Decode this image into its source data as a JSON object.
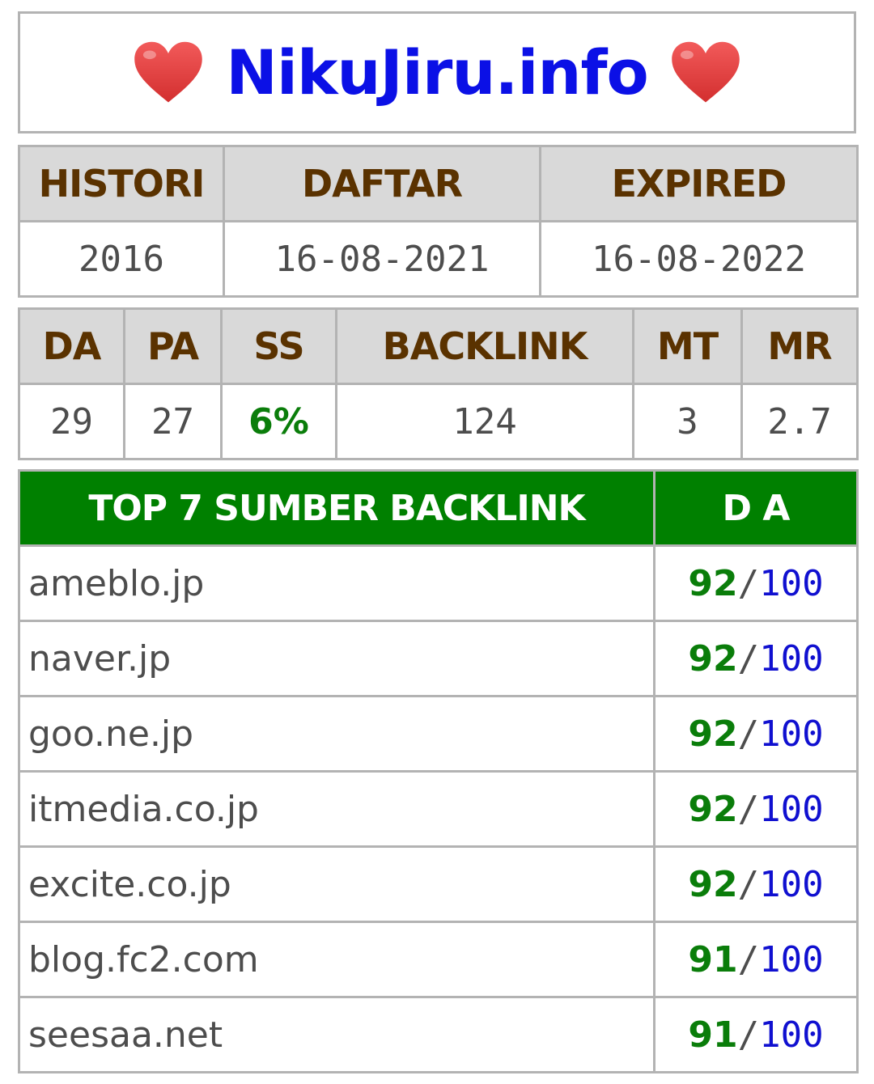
{
  "header": {
    "site_name": "NikuJiru.info",
    "left_icon": "heart-icon",
    "right_icon": "heart-icon",
    "heart_color": "#e53935"
  },
  "dates": {
    "headers": [
      "HISTORI",
      "DAFTAR",
      "EXPIRED"
    ],
    "values": [
      "2016",
      "16-08-2021",
      "16-08-2022"
    ]
  },
  "metrics": {
    "headers": [
      "DA",
      "PA",
      "SS",
      "BACKLINK",
      "MT",
      "MR"
    ],
    "values": [
      "29",
      "27",
      "6%",
      "124",
      "3",
      "2.7"
    ]
  },
  "backlinks": {
    "header_source": "TOP 7 SUMBER BACKLINK",
    "header_da": "D A",
    "separator": "/",
    "max": "100",
    "rows": [
      {
        "domain": "ameblo.jp",
        "da": "92"
      },
      {
        "domain": "naver.jp",
        "da": "92"
      },
      {
        "domain": "goo.ne.jp",
        "da": "92"
      },
      {
        "domain": "itmedia.co.jp",
        "da": "92"
      },
      {
        "domain": "excite.co.jp",
        "da": "92"
      },
      {
        "domain": "blog.fc2.com",
        "da": "91"
      },
      {
        "domain": "seesaa.net",
        "da": "91"
      }
    ]
  },
  "colors": {
    "header_bg": "#d9d9d9",
    "header_text": "#5a3200",
    "green_header_bg": "#008000",
    "score_green": "#0a7d0a",
    "score_blue": "#1010d0",
    "site_name_blue": "#0b10e6"
  }
}
